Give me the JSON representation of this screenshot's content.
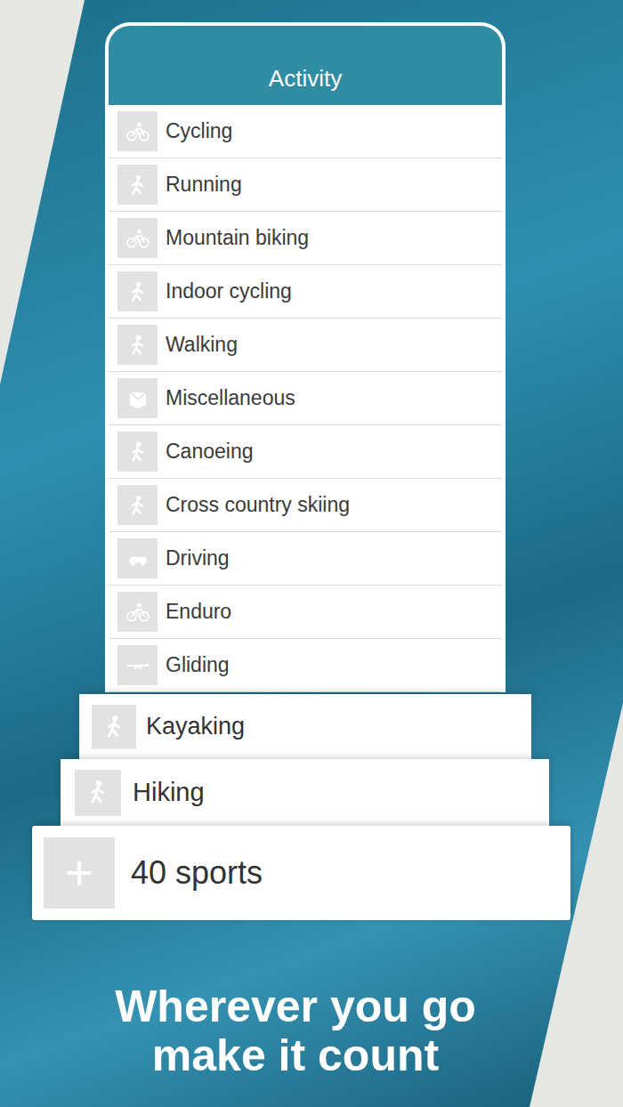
{
  "header": {
    "title": "Activity"
  },
  "activities": [
    {
      "name": "Cycling"
    },
    {
      "name": "Running"
    },
    {
      "name": "Mountain biking"
    },
    {
      "name": "Indoor cycling"
    },
    {
      "name": "Walking"
    },
    {
      "name": "Miscellaneous"
    },
    {
      "name": "Canoeing"
    },
    {
      "name": "Cross country skiing"
    },
    {
      "name": "Driving"
    },
    {
      "name": "Enduro"
    },
    {
      "name": "Gliding"
    }
  ],
  "featured": [
    {
      "name": "Kayaking"
    },
    {
      "name": "Hiking"
    }
  ],
  "more": {
    "icon": "+",
    "label": "40 sports"
  },
  "tagline": [
    "Wherever you go",
    "make it count"
  ]
}
